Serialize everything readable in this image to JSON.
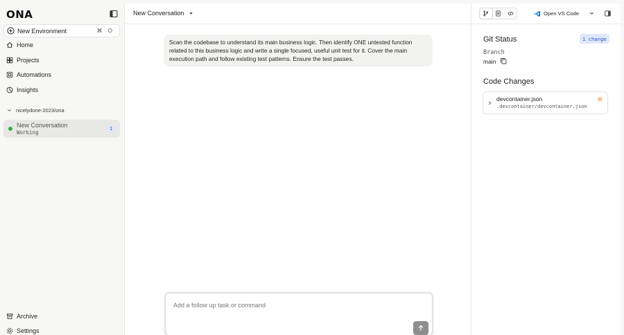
{
  "sidebar": {
    "logo": "ONA",
    "new_environment": {
      "label": "New Environment",
      "shortcut": "⌘ O"
    },
    "nav": [
      {
        "label": "Home",
        "icon": "home-icon"
      },
      {
        "label": "Projects",
        "icon": "projects-icon"
      },
      {
        "label": "Automations",
        "icon": "automations-icon"
      },
      {
        "label": "Insights",
        "icon": "insights-icon"
      }
    ],
    "group": {
      "label": "nicelydone-2023/ona",
      "icon": "chevron-down-icon"
    },
    "conversation": {
      "title": "New Conversation",
      "status": "Working",
      "count": "1",
      "status_color": "#2fb344"
    },
    "bottom": [
      {
        "label": "Archive",
        "icon": "archive-icon"
      },
      {
        "label": "Settings",
        "icon": "gear-icon"
      }
    ]
  },
  "main": {
    "title": "New Conversation",
    "message": "Scan the codebase to understand its main business logic. Then identify ONE untested function related to this business logic and write a single focused, useful unit test for it. Cover the main execution path and follow existing test patterns. Ensure the test passes.",
    "composer": {
      "placeholder": "Add a follow up task or command"
    }
  },
  "panel": {
    "open_vscode": "Open VS Code",
    "git_status": {
      "title": "Git Status",
      "badge": "1 change",
      "branch_label": "Branch",
      "branch": "main"
    },
    "code_changes": {
      "title": "Code Changes",
      "files": [
        {
          "name": "devcontainer.json",
          "path": ".devcontainer/devcontainer.json",
          "status": "U"
        }
      ]
    }
  },
  "colors": {
    "accent_blue": "#2457c5",
    "badge_bg": "#dfe8fb",
    "status_green": "#2fb344",
    "untracked_orange": "#d9822b"
  }
}
